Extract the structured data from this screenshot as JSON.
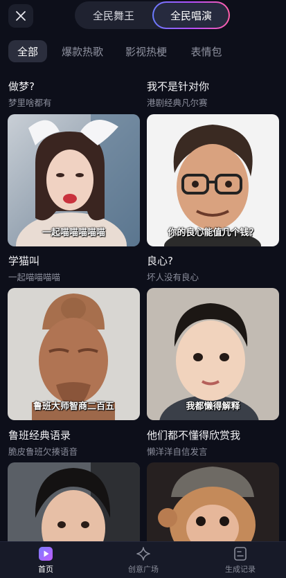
{
  "header": {
    "close_icon": "close-icon",
    "tabs": [
      {
        "label": "全民舞王",
        "active": false
      },
      {
        "label": "全民唱演",
        "active": true
      }
    ],
    "accent_gradient": [
      "#6a7cff",
      "#b44dff",
      "#ff5fa8"
    ]
  },
  "categories": [
    {
      "label": "全部",
      "active": true
    },
    {
      "label": "爆款热歌",
      "active": false
    },
    {
      "label": "影视热梗",
      "active": false
    },
    {
      "label": "表情包",
      "active": false
    }
  ],
  "items": [
    {
      "title": "做梦?",
      "subtitle": "梦里啥都有",
      "caption": ""
    },
    {
      "title": "我不是针对你",
      "subtitle": "港剧经典凡尔赛",
      "caption": ""
    },
    {
      "title": "学猫叫",
      "subtitle": "一起喵喵喵喵",
      "caption": "一起喵喵喵喵喵"
    },
    {
      "title": "良心?",
      "subtitle": "坏人没有良心",
      "caption": "你的良心能值几个钱？"
    },
    {
      "title": "鲁班经典语录",
      "subtitle": "脆皮鲁班欠揍语音",
      "caption": "鲁班大师智商二百五"
    },
    {
      "title": "他们都不懂得欣赏我",
      "subtitle": "懒洋洋自信发言",
      "caption": "我都懒得解释"
    },
    {
      "title": "",
      "subtitle": "",
      "caption": ""
    },
    {
      "title": "",
      "subtitle": "",
      "caption": ""
    }
  ],
  "bottom_nav": [
    {
      "label": "首页",
      "icon": "home-play-icon",
      "active": true
    },
    {
      "label": "创意广场",
      "icon": "sparkle-icon",
      "active": false
    },
    {
      "label": "生成记录",
      "icon": "record-icon",
      "active": false
    }
  ]
}
